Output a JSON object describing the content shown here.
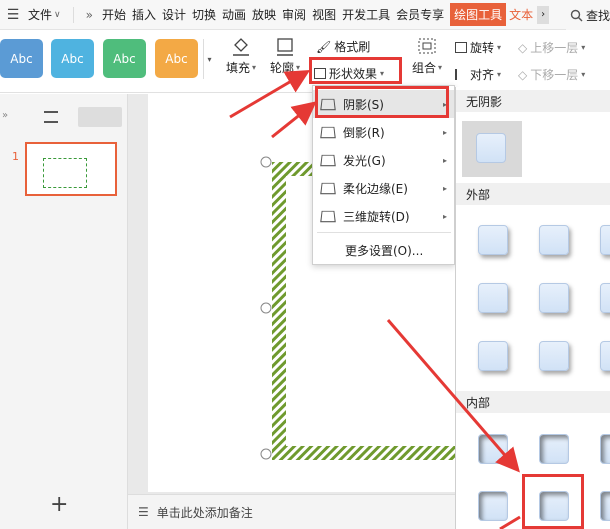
{
  "menubar": {
    "file": "文件",
    "tabs": [
      "开始",
      "插入",
      "设计",
      "切换",
      "动画",
      "放映",
      "审阅",
      "视图",
      "开发工具",
      "会员专享"
    ],
    "draw_tools": "绘图工具",
    "text_tools": "文本",
    "search": "查找"
  },
  "ribbon": {
    "styles": [
      {
        "label": "Abc",
        "color": "#5b9bd5"
      },
      {
        "label": "Abc",
        "color": "#4fb3e0"
      },
      {
        "label": "Abc",
        "color": "#4fbd7c"
      },
      {
        "label": "Abc",
        "color": "#f3a945"
      }
    ],
    "fill": "填充",
    "outline": "轮廓",
    "format_painter": "格式刷",
    "shape_effects": "形状效果",
    "group": "组合",
    "rotate": "旋转",
    "align": "对齐",
    "bring_forward": "上移一层",
    "send_backward": "下移一层"
  },
  "left_panel": {
    "slide_number": "1"
  },
  "menu": {
    "items": [
      {
        "label": "阴影(S)"
      },
      {
        "label": "倒影(R)"
      },
      {
        "label": "发光(G)"
      },
      {
        "label": "柔化边缘(E)"
      },
      {
        "label": "三维旋转(D)"
      }
    ],
    "more": "更多设置(O)..."
  },
  "gallery": {
    "no_shadow": "无阴影",
    "outer": "外部",
    "inner": "内部"
  },
  "notes": {
    "placeholder": "单击此处添加备注"
  },
  "colors": {
    "accent": "#e8613a",
    "highlight": "#e53935",
    "pattern": "#6f9a2e"
  }
}
